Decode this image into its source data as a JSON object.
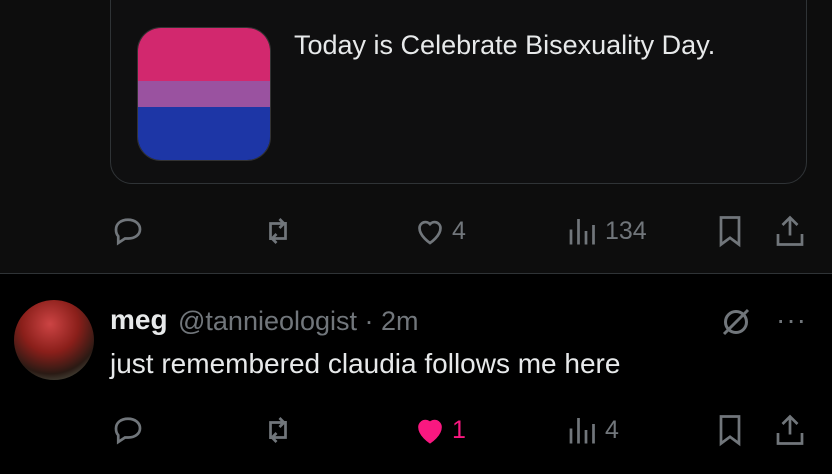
{
  "quoted_post": {
    "text": "Today is Celebrate Bisexuality Day.",
    "flag_colors": [
      "#d2286e",
      "#9a52a0",
      "#1d36a6"
    ]
  },
  "post1_actions": {
    "reply_count": "",
    "repost_count": "",
    "like_count": "4",
    "view_count": "134"
  },
  "reply_post": {
    "display_name": "meg",
    "handle_time": "@tannieologist · 2m",
    "text": "just remembered claudia follows me here",
    "more_icon": "more-horizontal-icon"
  },
  "post2_actions": {
    "like_count": "1",
    "view_count": "4"
  },
  "colors": {
    "like_active": "#f91880",
    "muted": "#71767b",
    "text": "#e7e9ea"
  }
}
